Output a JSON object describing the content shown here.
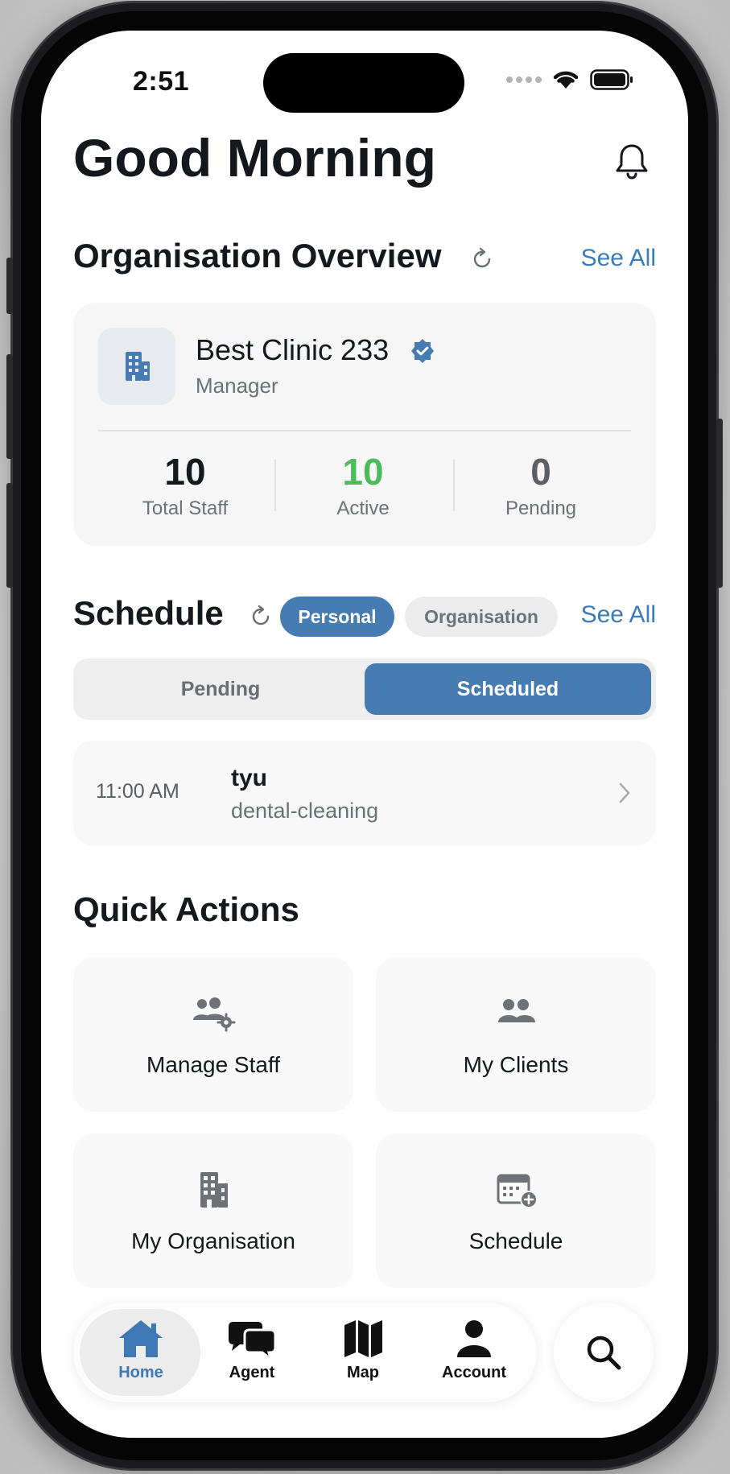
{
  "status_bar": {
    "time": "2:51"
  },
  "header": {
    "greeting": "Good Morning"
  },
  "organisation_overview": {
    "title": "Organisation Overview",
    "see_all": "See All",
    "org_name": "Best Clinic 233",
    "role": "Manager",
    "stats": [
      {
        "value": "10",
        "label": "Total Staff",
        "color": "#15181c"
      },
      {
        "value": "10",
        "label": "Active",
        "color": "#4dbb5c"
      },
      {
        "value": "0",
        "label": "Pending",
        "color": "#5b6067"
      }
    ]
  },
  "schedule": {
    "title": "Schedule",
    "filters": [
      "Personal",
      "Organisation"
    ],
    "selected_filter": "Personal",
    "see_all": "See All",
    "segments": [
      "Pending",
      "Scheduled"
    ],
    "selected_segment": "Scheduled",
    "appointments": [
      {
        "time": "11:00 AM",
        "name": "tyu",
        "type": "dental-cleaning"
      }
    ]
  },
  "quick_actions": {
    "title": "Quick Actions",
    "items": [
      {
        "label": "Manage Staff",
        "icon": "manage-staff-icon"
      },
      {
        "label": "My Clients",
        "icon": "clients-icon"
      },
      {
        "label": "My Organisation",
        "icon": "building-icon"
      },
      {
        "label": "Schedule",
        "icon": "calendar-add-icon"
      }
    ]
  },
  "tab_bar": {
    "items": [
      {
        "label": "Home",
        "icon": "home-icon",
        "active": true
      },
      {
        "label": "Agent",
        "icon": "chat-bubbles-icon",
        "active": false
      },
      {
        "label": "Map",
        "icon": "map-icon",
        "active": false
      },
      {
        "label": "Account",
        "icon": "person-icon",
        "active": false
      }
    ],
    "search_icon": "search-icon"
  },
  "colors": {
    "accent": "#477cb2",
    "link": "#3c7ab8",
    "active_green": "#4dbb5c"
  }
}
